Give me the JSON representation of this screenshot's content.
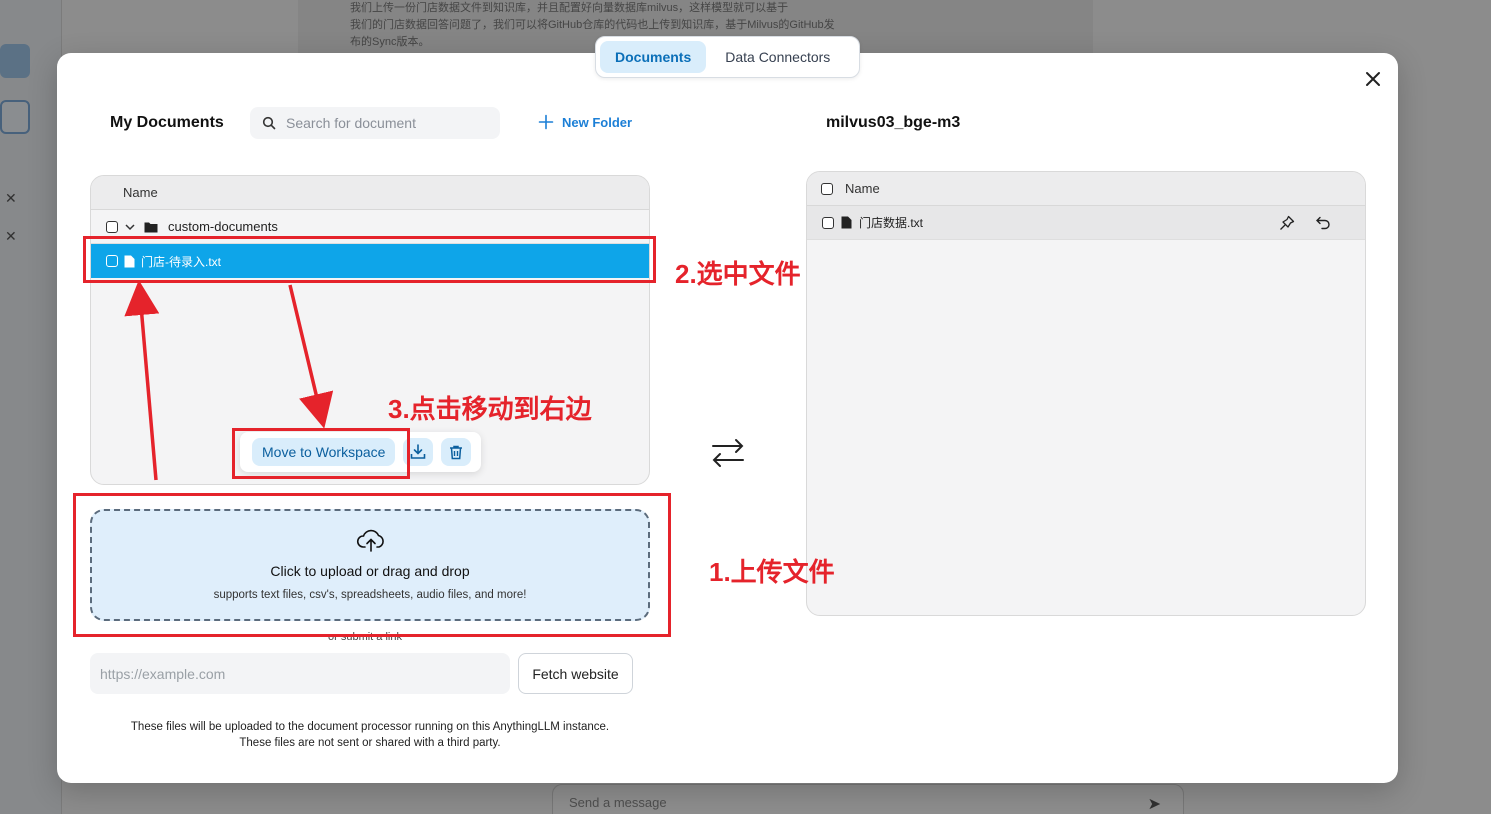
{
  "background": {
    "doc_text": [
      "我们上传一份门店数据文件到知识库，并且配置好向量数据库milvus，这样模型就可以基于",
      "我们的门店数据回答问题了，我们可以将GitHub仓库的代码也上传到知识库，基于Milvus的GitHub发",
      "布的Sync版本。"
    ],
    "message_placeholder": "Send a message"
  },
  "tabs": [
    {
      "label": "Documents",
      "active": true
    },
    {
      "label": "Data Connectors",
      "active": false
    }
  ],
  "my_documents": {
    "title": "My Documents",
    "search_placeholder": "Search for document",
    "new_folder_label": "New Folder",
    "header_name": "Name",
    "folder_name": "custom-documents",
    "file_name": "门店-待录入.txt"
  },
  "actions": {
    "move_label": "Move to Workspace"
  },
  "workspace": {
    "title": "milvus03_bge-m3",
    "header_name": "Name",
    "file_name": "门店数据.txt"
  },
  "upload": {
    "title": "Click to upload or drag and drop",
    "subtitle": "supports text files, csv's, spreadsheets, audio files, and more!",
    "or_link": "or submit a link",
    "url_placeholder": "https://example.com",
    "fetch_label": "Fetch website",
    "disclaimer_line1": "These files will be uploaded to the document processor running on this AnythingLLM instance.",
    "disclaimer_line2": "These files are not sent or shared with a third party."
  },
  "annotations": {
    "step1": "1.上传文件",
    "step2": "2.选中文件",
    "step3": "3.点击移动到右边"
  },
  "colors": {
    "accent": "#0ea5e9",
    "annotation_red": "#e5232b",
    "tab_active_bg": "#d9edfb"
  }
}
